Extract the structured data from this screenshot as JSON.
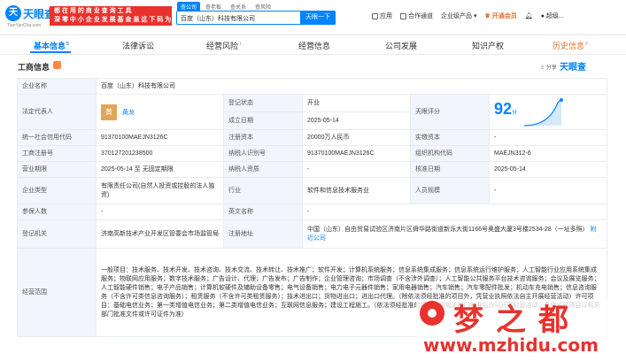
{
  "header": {
    "logo_text": "天眼查",
    "logo_mark": "天",
    "logo_sub": "TianYanCha.com",
    "promo_line1": "都 在 用 的 商 业 查 询 工 具",
    "promo_line2": "深 零 中 小 企 业 发 展 基 金 盖 这 下 码 为",
    "search_tabs": [
      "查公司",
      "查老板",
      "查关系",
      "查风险"
    ],
    "search_value": "百度（山东）科技有限公司",
    "search_button": "天眼一下",
    "nav": [
      "应用",
      "合作通道",
      "企业级产品",
      "开通会员",
      "超级..."
    ]
  },
  "tabs": [
    {
      "label": "基本信息",
      "count": "5"
    },
    {
      "label": "法律诉讼",
      "count": ""
    },
    {
      "label": "经营风险",
      "count": "1"
    },
    {
      "label": "经营信息",
      "count": ""
    },
    {
      "label": "公司发展",
      "count": ""
    },
    {
      "label": "知识产权",
      "count": ""
    },
    {
      "label": "历史信息",
      "count": "2"
    }
  ],
  "section": {
    "title": "工商信息",
    "share_label": "分享",
    "brand": "天眼查"
  },
  "table": {
    "company_name_label": "企业名称",
    "company_name": "百度（山东）科技有限公司",
    "legal_rep_label": "法定代表人",
    "legal_rep_avatar": "黄",
    "legal_rep": "黄龙",
    "reg_status_label": "登记状态",
    "reg_status": "开业",
    "est_date_label": "成立日期",
    "est_date": "2025-05-14",
    "score_label": "天眼评分",
    "score": "92",
    "score_unit": "分",
    "credit_code_label": "统一社会信用代码",
    "credit_code": "91370100MAEJN3126C",
    "reg_capital_label": "注册资本",
    "reg_capital": "20000万人民币",
    "paid_capital_label": "实缴资本",
    "paid_capital": "-",
    "reg_no_label": "工商注册号",
    "reg_no": "370127201238500",
    "taxpayer_id_label": "纳税人识别号",
    "taxpayer_id": "91370100MAEJN3126C",
    "org_code_label": "组织机构代码",
    "org_code": "MAEJN312-6",
    "term_label": "营业期限",
    "term": "2025-05-14 至 无固定期限",
    "taxpayer_q_label": "纳税人资质",
    "taxpayer_q": "-",
    "approval_date_label": "核准日期",
    "approval_date": "2025-05-14",
    "type_label": "企业类型",
    "type": "有限责任公司(自然人投资或控股的法人独资)",
    "industry_label": "行业",
    "industry": "软件和信息技术服务业",
    "staff_label": "人员规模",
    "staff": "-",
    "insured_label": "参保人数",
    "insured": "-",
    "en_name_label": "英文名称",
    "en_name": "-",
    "authority_label": "登记机关",
    "authority": "济南高新技术产业开发区管委会市场监管局",
    "address_label": "注册地址",
    "address": "中国（山东）自由贸易试验区济南片区舜华路街道新泺大街1166号奥盛大厦3号楼2534-28（一址多照）",
    "address_link": "附近公司",
    "scope_label": "经营范围",
    "scope": "一般项目：技术服务、技术开发、技术咨询、技术交流、技术转让、技术推广；软件开发；计算机系统服务；信息系统集成服务；信息系统运行维护服务；人工智能行业应用系统集成服务；物联网应用服务；数字技术服务；广告设计、代理；广告发布；广告制作；企业管理咨询；市场调查（不含涉外调查）；人工智能公共服务平台技术咨询服务；会议及展览服务；人工智能硬件销售；电子产品销售；计算机软硬件及辅助设备零售；电气设备销售；电力电子元器件销售；家用电器销售；汽车销售；汽车零配件批发；机动车充电销售；信息咨询服务（不含许可类信息咨询服务）；租赁服务（不含许可类租赁服务）；技术进出口；货物进出口；进出口代理。（除依法须经批准的项目外，凭营业执照依法自主开展经营活动）许可项目：基础电信业务；第一类增值电信业务；第二类增值电信业务；互联网信息服务；建设工程施工。（依法须经批准的项目，经相关部门批准后方可开展经营活动，具体经营项目以相关部门批准文件或许可证件为准）"
  },
  "watermark": {
    "chars": "梦之都",
    "url": "www.mzhidu.com"
  }
}
